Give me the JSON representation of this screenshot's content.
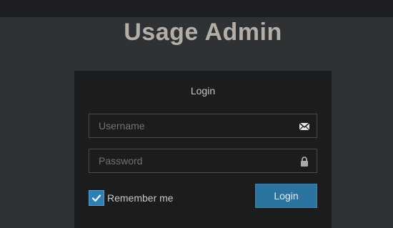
{
  "app": {
    "title": "Usage Admin"
  },
  "login": {
    "heading": "Login",
    "username_placeholder": "Username",
    "password_placeholder": "Password",
    "remember_label": "Remember me",
    "remember_checked": true,
    "submit_label": "Login"
  },
  "icons": {
    "username": "envelope-icon",
    "password": "lock-icon",
    "checkbox": "checkmark-icon"
  },
  "colors": {
    "background": "#2e3235",
    "topbar": "#1c1e21",
    "panel": "#1b1c1e",
    "accent": "#2c74a0",
    "title": "#b3aea6"
  }
}
